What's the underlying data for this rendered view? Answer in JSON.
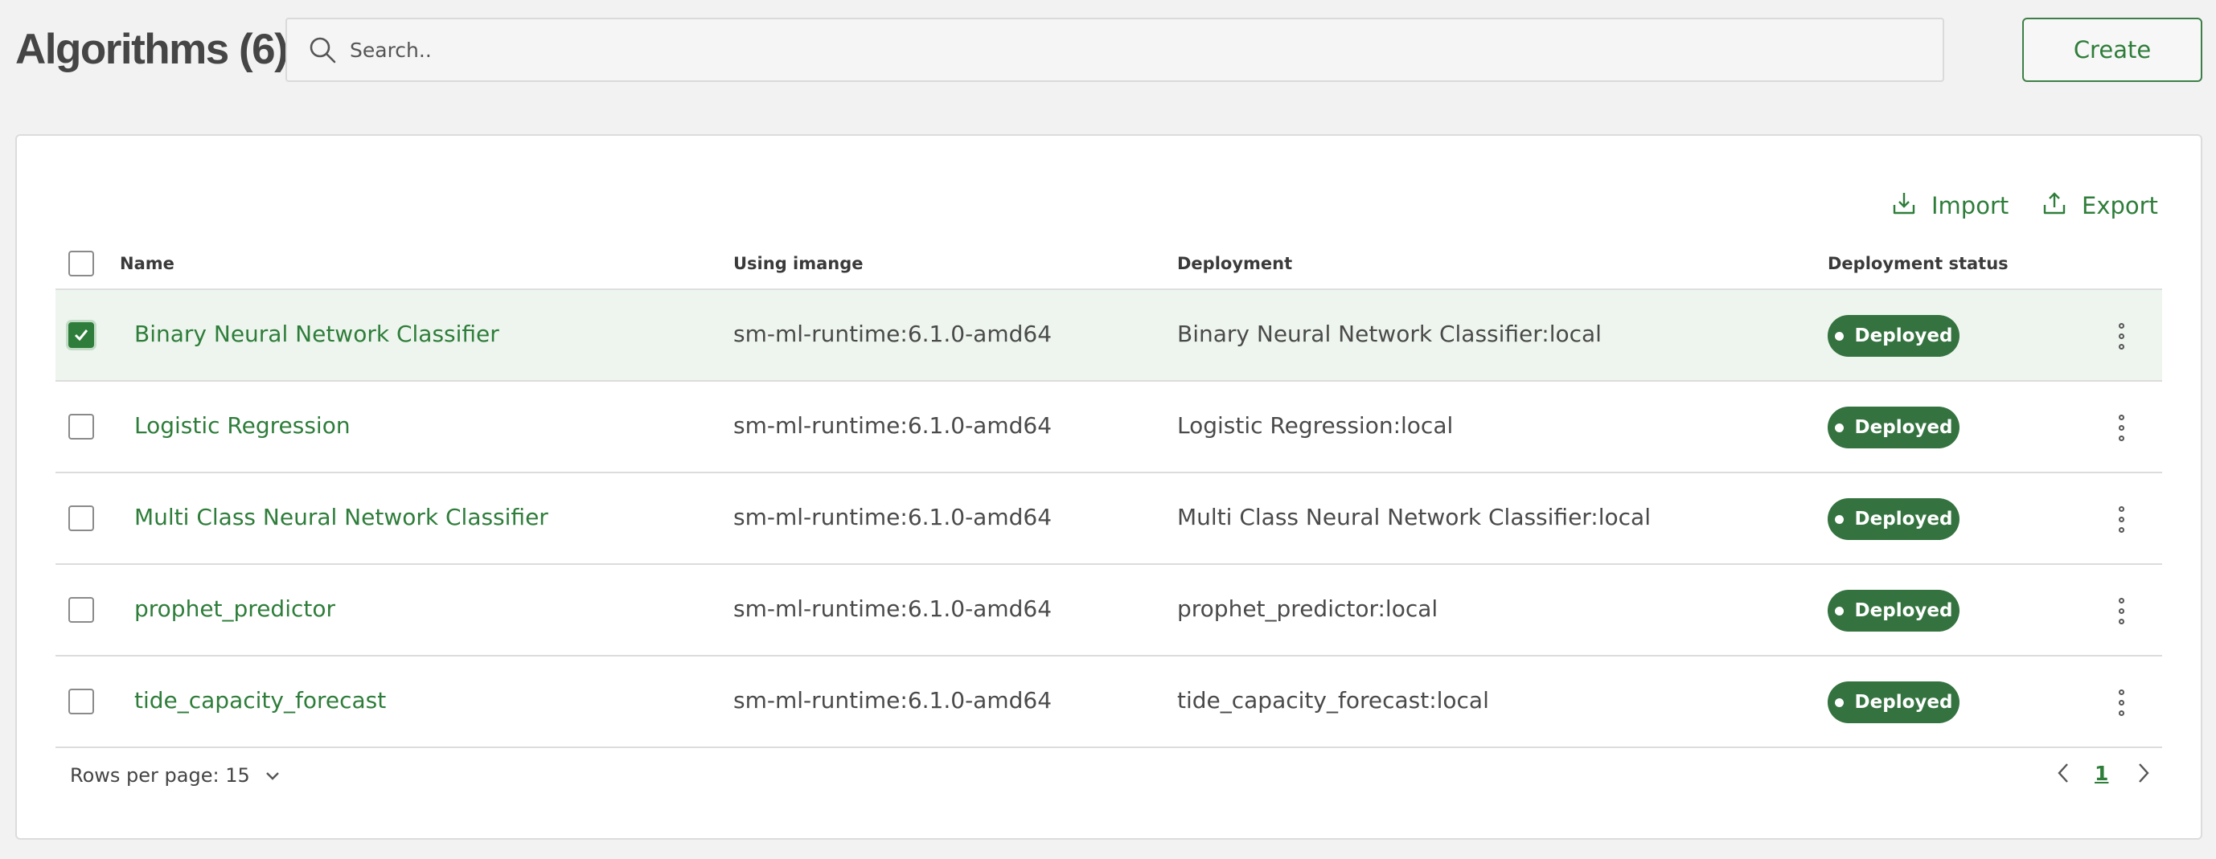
{
  "header": {
    "title": "Algorithms (6)",
    "search_placeholder": "Search..",
    "create_label": "Create"
  },
  "toolbar": {
    "import_label": "Import",
    "export_label": "Export"
  },
  "table": {
    "columns": {
      "name": "Name",
      "image": "Using imange",
      "deployment": "Deployment",
      "status": "Deployment status"
    },
    "rows": [
      {
        "name": "Binary Neural Network Classifier",
        "image": "sm-ml-runtime:6.1.0-amd64",
        "deployment": "Binary Neural Network Classifier:local",
        "status": "Deployed",
        "selected": true
      },
      {
        "name": "Logistic Regression",
        "image": "sm-ml-runtime:6.1.0-amd64",
        "deployment": "Logistic Regression:local",
        "status": "Deployed",
        "selected": false
      },
      {
        "name": "Multi Class Neural Network Classifier",
        "image": "sm-ml-runtime:6.1.0-amd64",
        "deployment": "Multi Class Neural Network Classifier:local",
        "status": "Deployed",
        "selected": false
      },
      {
        "name": "prophet_predictor",
        "image": "sm-ml-runtime:6.1.0-amd64",
        "deployment": "prophet_predictor:local",
        "status": "Deployed",
        "selected": false
      },
      {
        "name": "tide_capacity_forecast",
        "image": "sm-ml-runtime:6.1.0-amd64",
        "deployment": "tide_capacity_forecast:local",
        "status": "Deployed",
        "selected": false
      }
    ]
  },
  "footer": {
    "rows_per_page": "Rows per page: 15",
    "current_page": "1"
  },
  "colors": {
    "accent": "#2e7d3a",
    "badge": "#34733f",
    "selected_row": "#eef5ee"
  }
}
